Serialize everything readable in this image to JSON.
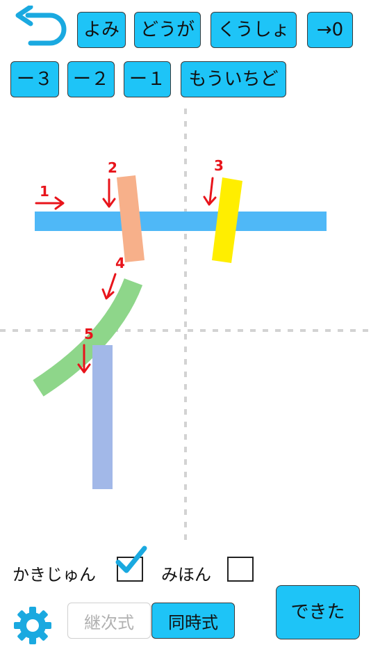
{
  "toolbar": {
    "back_icon": "undo-arrow-icon",
    "yomi": "よみ",
    "douga": "どうが",
    "kunshou": "くうしょ",
    "to_zero": "→0",
    "minus3": "ー３",
    "minus2": "ー２",
    "minus1": "ー１",
    "mouichido": "もういちど"
  },
  "strokes": [
    {
      "order": "1",
      "color": "#4fb8f7"
    },
    {
      "order": "2",
      "color": "#f7b08a"
    },
    {
      "order": "3",
      "color": "#ffee00"
    },
    {
      "order": "4",
      "color": "#8ed68a"
    },
    {
      "order": "5",
      "color": "#a2b8e8"
    }
  ],
  "options": {
    "kakijun_label": "かきじゅん",
    "kakijun_checked": true,
    "mihon_label": "みほん",
    "mihon_checked": false
  },
  "mode": {
    "keiji": "継次式",
    "douji": "同時式",
    "selected": "同時式"
  },
  "done": "できた",
  "colors": {
    "button": "#1ec4f7",
    "accent": "#1aa9e0",
    "arrow": "#e8141b"
  }
}
